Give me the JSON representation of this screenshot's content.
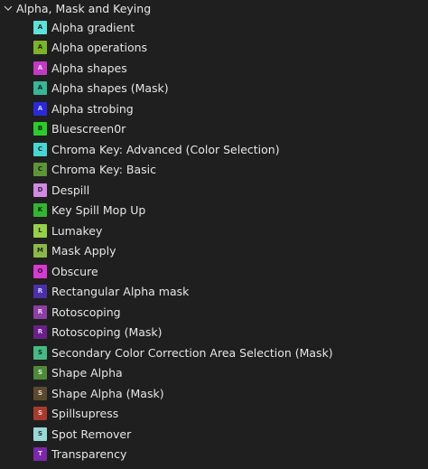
{
  "category": {
    "label": "Alpha, Mask and Keying",
    "expanded": true,
    "icon": "chevron-down-icon"
  },
  "items": [
    {
      "letter": "A",
      "label": "Alpha gradient",
      "color": "#5fe0d8",
      "text_color": "#10302e"
    },
    {
      "letter": "A",
      "label": "Alpha operations",
      "color": "#7cb22a",
      "text_color": "#1c2a08"
    },
    {
      "letter": "A",
      "label": "Alpha shapes",
      "color": "#c23ac4",
      "text_color": "#f0d0f0"
    },
    {
      "letter": "A",
      "label": "Alpha shapes (Mask)",
      "color": "#3ab596",
      "text_color": "#0c2a22"
    },
    {
      "letter": "A",
      "label": "Alpha strobing",
      "color": "#2a2ad8",
      "text_color": "#cfd0ff"
    },
    {
      "letter": "B",
      "label": "Bluescreen0r",
      "color": "#2ec92e",
      "text_color": "#0a2a0a"
    },
    {
      "letter": "C",
      "label": "Chroma Key: Advanced (Color Selection)",
      "color": "#49d6d2",
      "text_color": "#0c2e2c"
    },
    {
      "letter": "C",
      "label": "Chroma Key: Basic",
      "color": "#5d9438",
      "text_color": "#14240a"
    },
    {
      "letter": "D",
      "label": "Despill",
      "color": "#d08ae0",
      "text_color": "#3a1a44"
    },
    {
      "letter": "K",
      "label": "Key Spill Mop Up",
      "color": "#34b530",
      "text_color": "#0a260a"
    },
    {
      "letter": "L",
      "label": "Lumakey",
      "color": "#96d04a",
      "text_color": "#203010"
    },
    {
      "letter": "M",
      "label": "Mask Apply",
      "color": "#8ab84a",
      "text_color": "#1e2a10"
    },
    {
      "letter": "O",
      "label": "Obscure",
      "color": "#d63ad0",
      "text_color": "#3a0a38"
    },
    {
      "letter": "R",
      "label": "Rectangular Alpha mask",
      "color": "#4b30a8",
      "text_color": "#d8d0ff"
    },
    {
      "letter": "R",
      "label": "Rotoscoping",
      "color": "#8d3ea4",
      "text_color": "#ecd4f4"
    },
    {
      "letter": "R",
      "label": "Rotoscoping (Mask)",
      "color": "#6a2088",
      "text_color": "#e4c8f0"
    },
    {
      "letter": "S",
      "label": "Secondary Color Correction Area Selection (Mask)",
      "color": "#48b884",
      "text_color": "#0c2a1e"
    },
    {
      "letter": "S",
      "label": "Shape Alpha",
      "color": "#4e8a3a",
      "text_color": "#dff0d6"
    },
    {
      "letter": "S",
      "label": "Shape Alpha (Mask)",
      "color": "#5c4a30",
      "text_color": "#e8dcc8"
    },
    {
      "letter": "S",
      "label": "Spillsupress",
      "color": "#a83a2e",
      "text_color": "#f4d4d0"
    },
    {
      "letter": "S",
      "label": "Spot Remover",
      "color": "#9ad8d8",
      "text_color": "#1a3030"
    },
    {
      "letter": "T",
      "label": "Transparency",
      "color": "#7a28a8",
      "text_color": "#ecd0fa"
    }
  ]
}
